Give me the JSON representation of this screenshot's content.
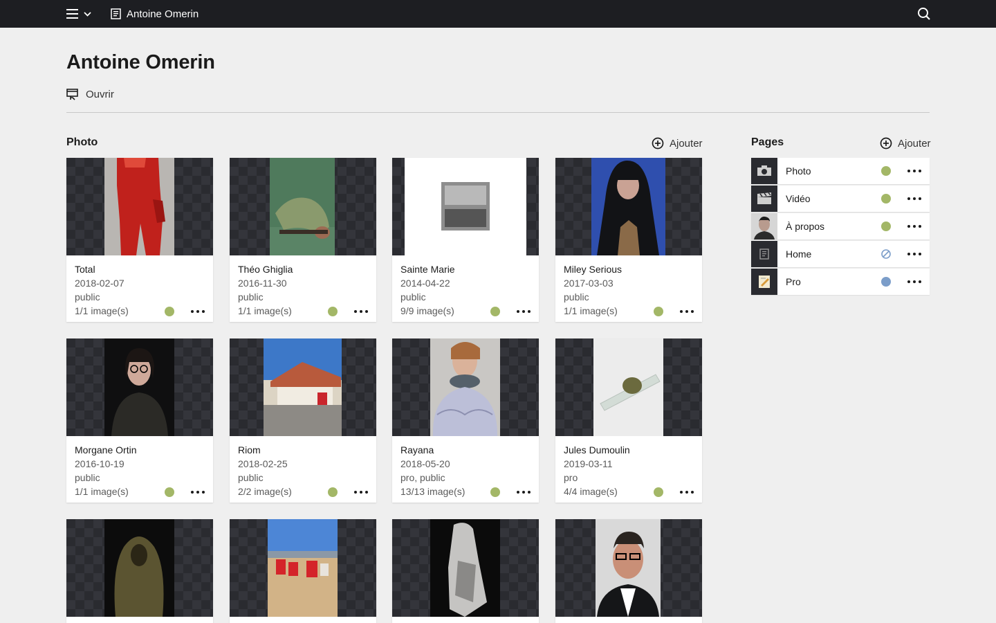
{
  "topbar": {
    "title": "Antoine Omerin"
  },
  "header": {
    "title": "Antoine Omerin",
    "open_label": "Ouvrir"
  },
  "photo_section": {
    "title": "Photo",
    "add_label": "Ajouter",
    "cards": [
      {
        "title": "Total",
        "date": "2018-02-07",
        "visibility": "public",
        "images": "1/1 image(s)",
        "status": "green"
      },
      {
        "title": "Théo Ghiglia",
        "date": "2016-11-30",
        "visibility": "public",
        "images": "1/1 image(s)",
        "status": "green"
      },
      {
        "title": "Sainte Marie",
        "date": "2014-04-22",
        "visibility": "public",
        "images": "9/9 image(s)",
        "status": "green"
      },
      {
        "title": "Miley Serious",
        "date": "2017-03-03",
        "visibility": "public",
        "images": "1/1 image(s)",
        "status": "green"
      },
      {
        "title": "Morgane Ortin",
        "date": "2016-10-19",
        "visibility": "public",
        "images": "1/1 image(s)",
        "status": "green"
      },
      {
        "title": "Riom",
        "date": "2018-02-25",
        "visibility": "public",
        "images": "2/2 image(s)",
        "status": "green"
      },
      {
        "title": "Rayana",
        "date": "2018-05-20",
        "visibility": "pro, public",
        "images": "13/13 image(s)",
        "status": "green"
      },
      {
        "title": "Jules Dumoulin",
        "date": "2019-03-11",
        "visibility": "pro",
        "images": "4/4 image(s)",
        "status": "green"
      }
    ]
  },
  "pages_section": {
    "title": "Pages",
    "add_label": "Ajouter",
    "items": [
      {
        "label": "Photo",
        "status": "published"
      },
      {
        "label": "Vidéo",
        "status": "published"
      },
      {
        "label": "À propos",
        "status": "published"
      },
      {
        "label": "Home",
        "status": "unpublished"
      },
      {
        "label": "Pro",
        "status": "draft"
      }
    ]
  },
  "colors": {
    "topbar": "#1d1e22",
    "published": "#a3b767",
    "draft": "#7b9dc9",
    "unpublished": "#7b9dc9",
    "background": "#efefef"
  }
}
